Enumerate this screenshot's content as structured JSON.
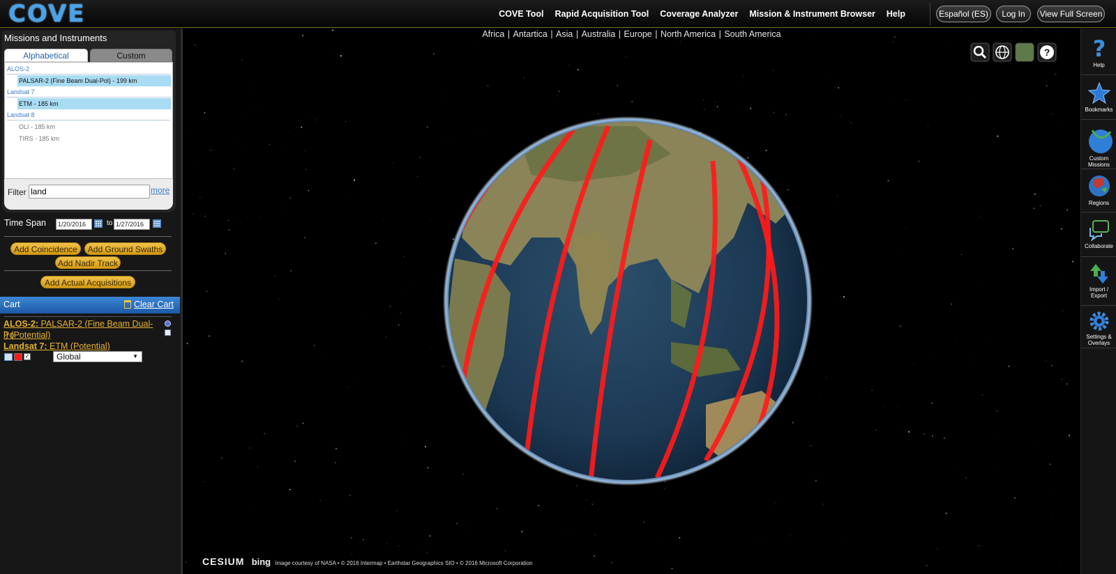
{
  "header": {
    "logo_text": "COVE",
    "nav": [
      "COVE Tool",
      "Rapid Acquisition Tool",
      "Coverage Analyzer",
      "Mission & Instrument Browser",
      "Help"
    ],
    "lang_button": "Español (ES)",
    "login_button": "Log In",
    "fullscreen_button": "View Full Screen"
  },
  "left_panel": {
    "title": "Missions and Instruments",
    "tabs": [
      "Alphabetical",
      "Custom"
    ],
    "groups": [
      {
        "name": "ALOS-2",
        "instruments": [
          {
            "label": "PALSAR-2 (Fine Beam Dual-Pol) - 199 km",
            "selected": true
          }
        ]
      },
      {
        "name": "Landsat 7",
        "instruments": [
          {
            "label": "ETM - 185 km",
            "selected": true
          }
        ]
      },
      {
        "name": "Landsat 8",
        "instruments": [
          {
            "label": "OLI - 185 km",
            "selected": false
          },
          {
            "label": "TIRS - 185 km",
            "selected": false
          }
        ]
      }
    ],
    "filter_label": "Filter",
    "filter_value": "land",
    "more_link": "more",
    "time_span_label": "Time Span",
    "date_from": "1/20/2016",
    "to_label": "to",
    "date_to": "1/27/2016",
    "buttons": {
      "coincidence": "Add Coincidence",
      "ground_swaths": "Add Ground Swaths",
      "nadir_track": "Add Nadir Track",
      "actual_acquisitions": "Add Actual Acquisitions"
    },
    "cart": {
      "title": "Cart",
      "clear": "Clear Cart",
      "items": [
        {
          "mission": "ALOS-2:",
          "line1": " PALSAR-2 (Fine Beam Dual-Po",
          "line2": "l) (Potential)"
        },
        {
          "mission": "Landsat 7:",
          "line1": " ETM (Potential)"
        }
      ],
      "region_select": "Global",
      "swath_color": "#ff1a1a"
    }
  },
  "viewport": {
    "continents": [
      "Africa",
      "Antartica",
      "Asia",
      "Australia",
      "Europe",
      "North America",
      "South America"
    ],
    "credits": {
      "cesium": "CESIUM",
      "bing": "bing",
      "text": "Image courtesy of NASA • © 2016 Intermap • Earthstar Geographics SIO • © 2016 Microsoft Corporation"
    },
    "tools": [
      "search-icon",
      "globe-icon",
      "imagery-icon",
      "help-icon"
    ]
  },
  "right_sidebar": [
    {
      "label": "Help",
      "icon": "question-icon"
    },
    {
      "label": "Bookmarks",
      "icon": "star-icon"
    },
    {
      "label": "Custom Missions",
      "icon": "satellite-globe-icon"
    },
    {
      "label": "Regions",
      "icon": "regions-globe-icon"
    },
    {
      "label": "Collaborate",
      "icon": "chat-icon"
    },
    {
      "label": "Import / Export",
      "icon": "import-export-icon"
    },
    {
      "label": "Settings & Overlays",
      "icon": "gear-icon"
    }
  ]
}
